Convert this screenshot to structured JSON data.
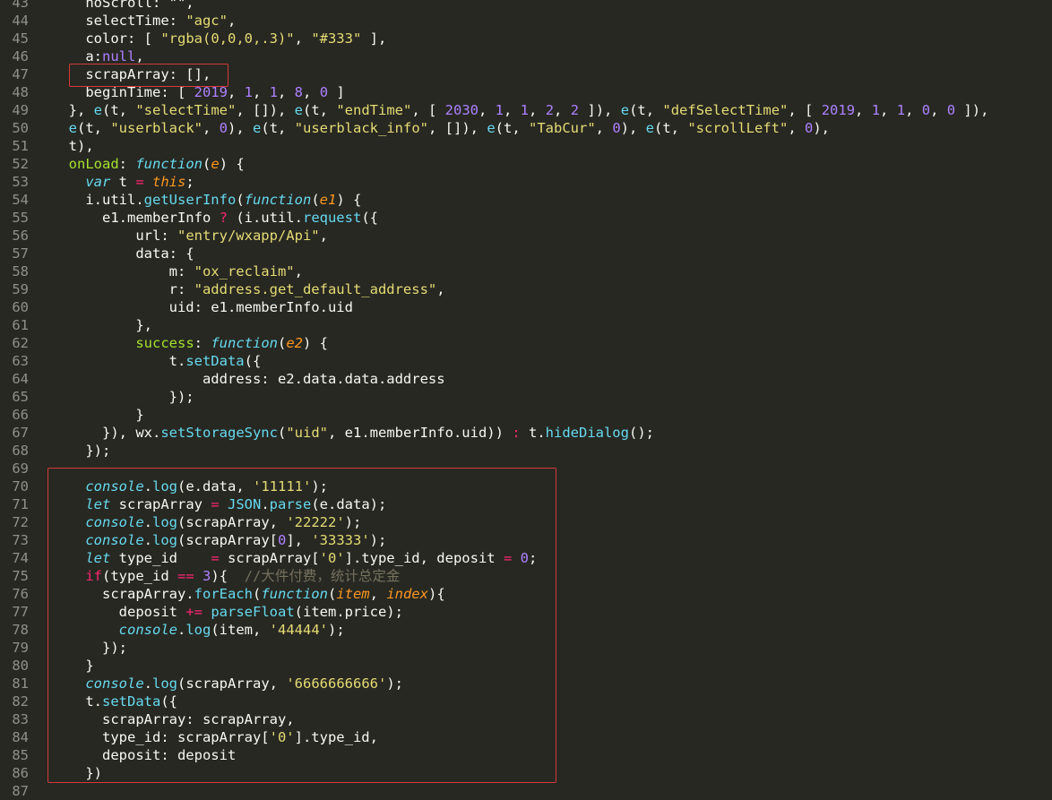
{
  "editor": {
    "lines": [
      {
        "n": "43",
        "t": [
          [
            "pl",
            "    noScroll: \"\","
          ]
        ]
      },
      {
        "n": "44",
        "t": [
          [
            "pl",
            "    selectTime: "
          ],
          [
            "st",
            "\"agc\""
          ],
          [
            "pl",
            ","
          ]
        ]
      },
      {
        "n": "45",
        "t": [
          [
            "pl",
            "    color: [ "
          ],
          [
            "st",
            "\"rgba(0,0,0,.3)\""
          ],
          [
            "pl",
            ", "
          ],
          [
            "st",
            "\"#333\""
          ],
          [
            "pl",
            " ],"
          ]
        ]
      },
      {
        "n": "46",
        "t": [
          [
            "pl",
            "    a:"
          ],
          [
            "nm",
            "null"
          ],
          [
            "pl",
            ","
          ]
        ]
      },
      {
        "n": "47",
        "t": [
          [
            "pl",
            "    scrapArray: [],"
          ]
        ]
      },
      {
        "n": "48",
        "t": [
          [
            "pl",
            "    beginTime: [ "
          ],
          [
            "nm",
            "2019"
          ],
          [
            "pl",
            ", "
          ],
          [
            "nm",
            "1"
          ],
          [
            "pl",
            ", "
          ],
          [
            "nm",
            "1"
          ],
          [
            "pl",
            ", "
          ],
          [
            "nm",
            "8"
          ],
          [
            "pl",
            ", "
          ],
          [
            "nm",
            "0"
          ],
          [
            "pl",
            " ]"
          ]
        ]
      },
      {
        "n": "49",
        "t": [
          [
            "pl",
            "  }, "
          ],
          [
            "fn",
            "e"
          ],
          [
            "pl",
            "(t, "
          ],
          [
            "st",
            "\"selectTime\""
          ],
          [
            "pl",
            ", []), "
          ],
          [
            "fn",
            "e"
          ],
          [
            "pl",
            "(t, "
          ],
          [
            "st",
            "\"endTime\""
          ],
          [
            "pl",
            ", [ "
          ],
          [
            "nm",
            "2030"
          ],
          [
            "pl",
            ", "
          ],
          [
            "nm",
            "1"
          ],
          [
            "pl",
            ", "
          ],
          [
            "nm",
            "1"
          ],
          [
            "pl",
            ", "
          ],
          [
            "nm",
            "2"
          ],
          [
            "pl",
            ", "
          ],
          [
            "nm",
            "2"
          ],
          [
            "pl",
            " ]), "
          ],
          [
            "fn",
            "e"
          ],
          [
            "pl",
            "(t, "
          ],
          [
            "st",
            "\"defSelectTime\""
          ],
          [
            "pl",
            ", [ "
          ],
          [
            "nm",
            "2019"
          ],
          [
            "pl",
            ", "
          ],
          [
            "nm",
            "1"
          ],
          [
            "pl",
            ", "
          ],
          [
            "nm",
            "1"
          ],
          [
            "pl",
            ", "
          ],
          [
            "nm",
            "0"
          ],
          [
            "pl",
            ", "
          ],
          [
            "nm",
            "0"
          ],
          [
            "pl",
            " ]),"
          ]
        ]
      },
      {
        "n": "50",
        "t": [
          [
            "pl",
            "  "
          ],
          [
            "fn",
            "e"
          ],
          [
            "pl",
            "(t, "
          ],
          [
            "st",
            "\"userblack\""
          ],
          [
            "pl",
            ", "
          ],
          [
            "nm",
            "0"
          ],
          [
            "pl",
            "), "
          ],
          [
            "fn",
            "e"
          ],
          [
            "pl",
            "(t, "
          ],
          [
            "st",
            "\"userblack_info\""
          ],
          [
            "pl",
            ", []), "
          ],
          [
            "fn",
            "e"
          ],
          [
            "pl",
            "(t, "
          ],
          [
            "st",
            "\"TabCur\""
          ],
          [
            "pl",
            ", "
          ],
          [
            "nm",
            "0"
          ],
          [
            "pl",
            "), "
          ],
          [
            "fn",
            "e"
          ],
          [
            "pl",
            "(t, "
          ],
          [
            "st",
            "\"scrollLeft\""
          ],
          [
            "pl",
            ", "
          ],
          [
            "nm",
            "0"
          ],
          [
            "pl",
            "),"
          ]
        ]
      },
      {
        "n": "51",
        "t": [
          [
            "pl",
            "  t),"
          ]
        ]
      },
      {
        "n": "52",
        "t": [
          [
            "pl",
            "  "
          ],
          [
            "pr",
            "onLoad"
          ],
          [
            "pl",
            ": "
          ],
          [
            "itk",
            "function"
          ],
          [
            "pl",
            "("
          ],
          [
            "pa",
            "e"
          ],
          [
            "pl",
            ") {"
          ]
        ]
      },
      {
        "n": "53",
        "t": [
          [
            "pl",
            "    "
          ],
          [
            "itk",
            "var"
          ],
          [
            "pl",
            " t "
          ],
          [
            "kw",
            "="
          ],
          [
            "pl",
            " "
          ],
          [
            "pa",
            "this"
          ],
          [
            "pl",
            ";"
          ]
        ]
      },
      {
        "n": "54",
        "t": [
          [
            "pl",
            "    i.util."
          ],
          [
            "fn",
            "getUserInfo"
          ],
          [
            "pl",
            "("
          ],
          [
            "itk",
            "function"
          ],
          [
            "pl",
            "("
          ],
          [
            "pa",
            "e1"
          ],
          [
            "pl",
            ") {"
          ]
        ]
      },
      {
        "n": "55",
        "t": [
          [
            "pl",
            "      e1.memberInfo "
          ],
          [
            "kw",
            "?"
          ],
          [
            "pl",
            " (i.util."
          ],
          [
            "fn",
            "request"
          ],
          [
            "pl",
            "({"
          ]
        ]
      },
      {
        "n": "56",
        "t": [
          [
            "pl",
            "          url: "
          ],
          [
            "st",
            "\"entry/wxapp/Api\""
          ],
          [
            "pl",
            ","
          ]
        ]
      },
      {
        "n": "57",
        "t": [
          [
            "pl",
            "          data: {"
          ]
        ]
      },
      {
        "n": "58",
        "t": [
          [
            "pl",
            "              m: "
          ],
          [
            "st",
            "\"ox_reclaim\""
          ],
          [
            "pl",
            ","
          ]
        ]
      },
      {
        "n": "59",
        "t": [
          [
            "pl",
            "              r: "
          ],
          [
            "st",
            "\"address.get_default_address\""
          ],
          [
            "pl",
            ","
          ]
        ]
      },
      {
        "n": "60",
        "t": [
          [
            "pl",
            "              uid: e1.memberInfo.uid"
          ]
        ]
      },
      {
        "n": "61",
        "t": [
          [
            "pl",
            "          },"
          ]
        ]
      },
      {
        "n": "62",
        "t": [
          [
            "pl",
            "          "
          ],
          [
            "pr",
            "success"
          ],
          [
            "pl",
            ": "
          ],
          [
            "itk",
            "function"
          ],
          [
            "pl",
            "("
          ],
          [
            "pa",
            "e2"
          ],
          [
            "pl",
            ") {"
          ]
        ]
      },
      {
        "n": "63",
        "t": [
          [
            "pl",
            "              t."
          ],
          [
            "fn",
            "setData"
          ],
          [
            "pl",
            "({"
          ]
        ]
      },
      {
        "n": "64",
        "t": [
          [
            "pl",
            "                  address: e2.data.data.address"
          ]
        ]
      },
      {
        "n": "65",
        "t": [
          [
            "pl",
            "              });"
          ]
        ]
      },
      {
        "n": "66",
        "t": [
          [
            "pl",
            "          }"
          ]
        ]
      },
      {
        "n": "67",
        "t": [
          [
            "pl",
            "      }), wx."
          ],
          [
            "fn",
            "setStorageSync"
          ],
          [
            "pl",
            "("
          ],
          [
            "st",
            "\"uid\""
          ],
          [
            "pl",
            ", e1.memberInfo.uid)) "
          ],
          [
            "kw",
            ":"
          ],
          [
            "pl",
            " t."
          ],
          [
            "fn",
            "hideDialog"
          ],
          [
            "pl",
            "();"
          ]
        ]
      },
      {
        "n": "68",
        "t": [
          [
            "pl",
            "    });"
          ]
        ]
      },
      {
        "n": "69",
        "t": [
          [
            "pl",
            ""
          ]
        ]
      },
      {
        "n": "70",
        "t": [
          [
            "pl",
            "    "
          ],
          [
            "itk",
            "console"
          ],
          [
            "pl",
            "."
          ],
          [
            "fn",
            "log"
          ],
          [
            "pl",
            "(e.data, "
          ],
          [
            "st",
            "'11111'"
          ],
          [
            "pl",
            ");"
          ]
        ]
      },
      {
        "n": "71",
        "t": [
          [
            "pl",
            "    "
          ],
          [
            "itk",
            "let"
          ],
          [
            "pl",
            " scrapArray "
          ],
          [
            "kw",
            "="
          ],
          [
            "pl",
            " "
          ],
          [
            "fn",
            "JSON"
          ],
          [
            "pl",
            "."
          ],
          [
            "fn",
            "parse"
          ],
          [
            "pl",
            "(e.data);"
          ]
        ]
      },
      {
        "n": "72",
        "t": [
          [
            "pl",
            "    "
          ],
          [
            "itk",
            "console"
          ],
          [
            "pl",
            "."
          ],
          [
            "fn",
            "log"
          ],
          [
            "pl",
            "(scrapArray, "
          ],
          [
            "st",
            "'22222'"
          ],
          [
            "pl",
            ");"
          ]
        ]
      },
      {
        "n": "73",
        "t": [
          [
            "pl",
            "    "
          ],
          [
            "itk",
            "console"
          ],
          [
            "pl",
            "."
          ],
          [
            "fn",
            "log"
          ],
          [
            "pl",
            "(scrapArray["
          ],
          [
            "nm",
            "0"
          ],
          [
            "pl",
            "], "
          ],
          [
            "st",
            "'33333'"
          ],
          [
            "pl",
            ");"
          ]
        ]
      },
      {
        "n": "74",
        "t": [
          [
            "pl",
            "    "
          ],
          [
            "itk",
            "let"
          ],
          [
            "pl",
            " type_id    "
          ],
          [
            "kw",
            "="
          ],
          [
            "pl",
            " scrapArray["
          ],
          [
            "st",
            "'0'"
          ],
          [
            "pl",
            "].type_id, deposit "
          ],
          [
            "kw",
            "="
          ],
          [
            "pl",
            " "
          ],
          [
            "nm",
            "0"
          ],
          [
            "pl",
            ";"
          ]
        ]
      },
      {
        "n": "75",
        "t": [
          [
            "pl",
            "    "
          ],
          [
            "kw",
            "if"
          ],
          [
            "pl",
            "(type_id "
          ],
          [
            "kw",
            "=="
          ],
          [
            "pl",
            " "
          ],
          [
            "nm",
            "3"
          ],
          [
            "pl",
            "){  "
          ],
          [
            "cm",
            "//大件付费，统计总定金"
          ]
        ]
      },
      {
        "n": "76",
        "t": [
          [
            "pl",
            "      scrapArray."
          ],
          [
            "fn",
            "forEach"
          ],
          [
            "pl",
            "("
          ],
          [
            "itk",
            "function"
          ],
          [
            "pl",
            "("
          ],
          [
            "pa",
            "item"
          ],
          [
            "pl",
            ", "
          ],
          [
            "pa",
            "index"
          ],
          [
            "pl",
            "){"
          ]
        ]
      },
      {
        "n": "77",
        "t": [
          [
            "pl",
            "        deposit "
          ],
          [
            "kw",
            "+="
          ],
          [
            "pl",
            " "
          ],
          [
            "fn",
            "parseFloat"
          ],
          [
            "pl",
            "(item.price);"
          ]
        ]
      },
      {
        "n": "78",
        "t": [
          [
            "pl",
            "        "
          ],
          [
            "itk",
            "console"
          ],
          [
            "pl",
            "."
          ],
          [
            "fn",
            "log"
          ],
          [
            "pl",
            "(item, "
          ],
          [
            "st",
            "'44444'"
          ],
          [
            "pl",
            ");"
          ]
        ]
      },
      {
        "n": "79",
        "t": [
          [
            "pl",
            "      });"
          ]
        ]
      },
      {
        "n": "80",
        "t": [
          [
            "pl",
            "    }"
          ]
        ]
      },
      {
        "n": "81",
        "t": [
          [
            "pl",
            "    "
          ],
          [
            "itk",
            "console"
          ],
          [
            "pl",
            "."
          ],
          [
            "fn",
            "log"
          ],
          [
            "pl",
            "(scrapArray, "
          ],
          [
            "st",
            "'6666666666'"
          ],
          [
            "pl",
            ");"
          ]
        ]
      },
      {
        "n": "82",
        "t": [
          [
            "pl",
            "    t."
          ],
          [
            "fn",
            "setData"
          ],
          [
            "pl",
            "({"
          ]
        ]
      },
      {
        "n": "83",
        "t": [
          [
            "pl",
            "      scrapArray: scrapArray,"
          ]
        ]
      },
      {
        "n": "84",
        "t": [
          [
            "pl",
            "      type_id: scrapArray["
          ],
          [
            "st",
            "'0'"
          ],
          [
            "pl",
            "].type_id,"
          ]
        ]
      },
      {
        "n": "85",
        "t": [
          [
            "pl",
            "      deposit: deposit"
          ]
        ]
      },
      {
        "n": "86",
        "t": [
          [
            "pl",
            "    })"
          ]
        ]
      },
      {
        "n": "87",
        "t": [
          [
            "pl",
            ""
          ]
        ]
      }
    ]
  },
  "colors": {
    "background": "#272822",
    "highlight_box": "#d63a3a"
  }
}
